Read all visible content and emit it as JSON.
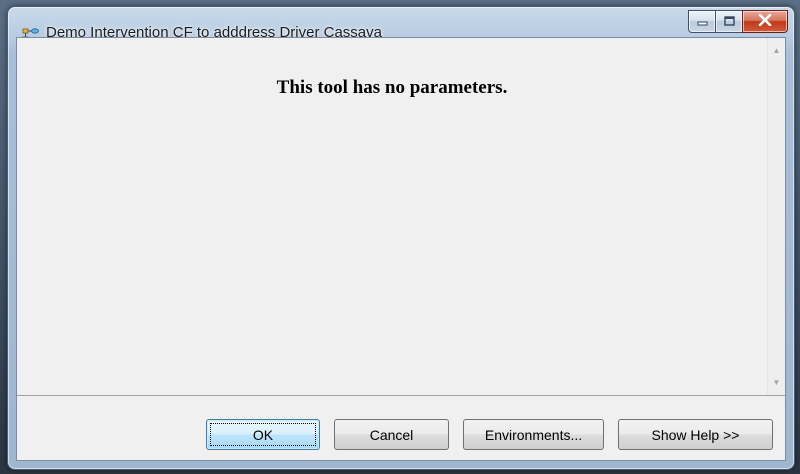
{
  "window": {
    "title": "Demo Intervention CF to adddress Driver Cassava",
    "app_icon": "model-tool-icon",
    "caption_buttons": {
      "minimize": "minimize-icon",
      "maximize": "maximize-icon",
      "close": "close-icon"
    }
  },
  "content": {
    "message": "This tool has no parameters."
  },
  "scrollbar": {
    "up_arrow": "▲",
    "down_arrow": "▼"
  },
  "buttons": {
    "ok": "OK",
    "cancel": "Cancel",
    "environments": "Environments...",
    "show_help": "Show Help >>"
  },
  "colors": {
    "close_button": "#c2391b",
    "default_button_border": "#3c7fb1",
    "client_background": "#f0f0f0"
  }
}
